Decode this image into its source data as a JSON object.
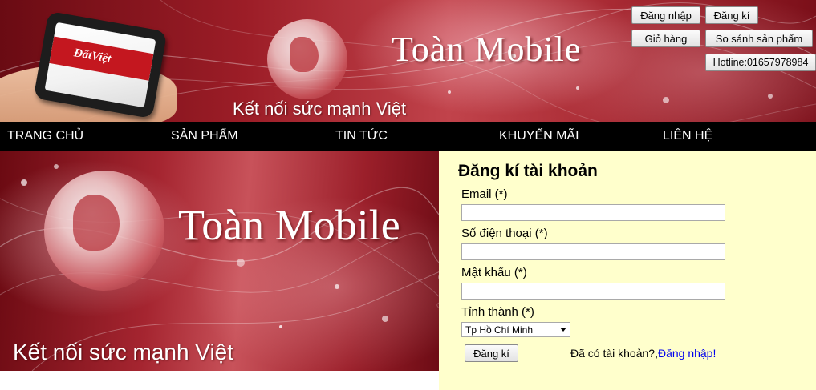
{
  "header": {
    "brand": "Toàn Mobile",
    "slogan": "Kết nối sức mạnh Việt",
    "phone_logo": "ĐấtViệt",
    "buttons": {
      "login": "Đăng nhập",
      "register": "Đăng kí",
      "cart": "Giỏ hàng",
      "compare": "So sánh sản phẩm",
      "hotline": "Hotline:01657978984"
    }
  },
  "nav": {
    "items": [
      "TRANG CHỦ",
      "SẢN PHẨM",
      "TIN TỨC",
      "KHUYẾN MÃI",
      "LIÊN HỆ"
    ]
  },
  "hero": {
    "brand": "Toàn Mobile",
    "slogan": "Kết nối sức mạnh Việt"
  },
  "register_form": {
    "title": "Đăng kí tài khoản",
    "email_label": "Email (*)",
    "email_value": "",
    "phone_label": "Số điện thoại (*)",
    "phone_value": "",
    "password_label": "Mật khẩu (*)",
    "password_value": "",
    "city_label": "Tỉnh thành (*)",
    "city_selected": "Tp Hồ Chí Minh",
    "submit_label": "Đăng kí",
    "have_account_text": "Đã có tài khoản?,",
    "login_link": "Đăng nhập!"
  },
  "colors": {
    "banner_red": "#a52530",
    "nav_bg": "#000000",
    "form_bg": "#ffffcc",
    "link_blue": "#0000ee"
  }
}
